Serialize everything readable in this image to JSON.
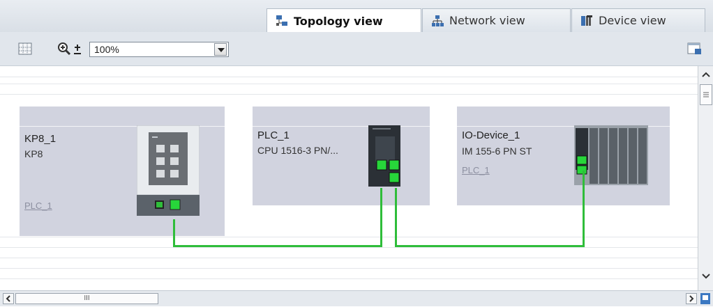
{
  "tabs": [
    {
      "label": "Topology view",
      "icon": "topology-icon",
      "active": true
    },
    {
      "label": "Network view",
      "icon": "network-icon",
      "active": false
    },
    {
      "label": "Device view",
      "icon": "device-icon",
      "active": false
    }
  ],
  "toolbar": {
    "zoom_value": "100%"
  },
  "devices": [
    {
      "name": "KP8_1",
      "type": "KP8",
      "subnet_link": "PLC_1"
    },
    {
      "name": "PLC_1",
      "type": "CPU 1516-3 PN/...",
      "subnet_link": ""
    },
    {
      "name": "IO-Device_1",
      "type": "IM 155-6 PN ST",
      "subnet_link": "PLC_1"
    }
  ],
  "scrollbar": {
    "h_thumb_grip": "III"
  },
  "colors": {
    "connection": "#2fbd3a",
    "device_bg": "#d1d3df",
    "port": "#27d63a"
  }
}
